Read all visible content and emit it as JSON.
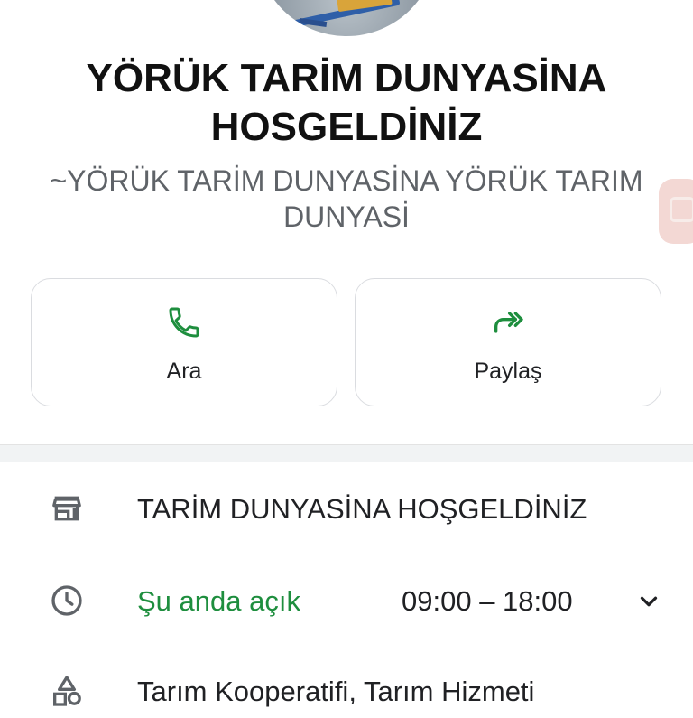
{
  "profile": {
    "title": "YÖRÜK TARİM DUNYASİNA HOSGELDİNİZ",
    "subtitle": "~YÖRÜK TARİM DUNYASİNA YÖRÜK TARIM DUNYASİ"
  },
  "actions": [
    {
      "label": "Ara",
      "icon": "phone-icon"
    },
    {
      "label": "Paylaş",
      "icon": "share-icon"
    }
  ],
  "details": {
    "business_name": "TARİM DUNYASİNA HOŞGELDİNİZ",
    "status": "Şu anda açık",
    "hours": "09:00 – 18:00",
    "category": "Tarım Kooperatifi, Tarım Hizmeti"
  },
  "colors": {
    "accent": "#1e8e3e",
    "icon_gray": "#5f6368",
    "border": "#dadce0"
  }
}
